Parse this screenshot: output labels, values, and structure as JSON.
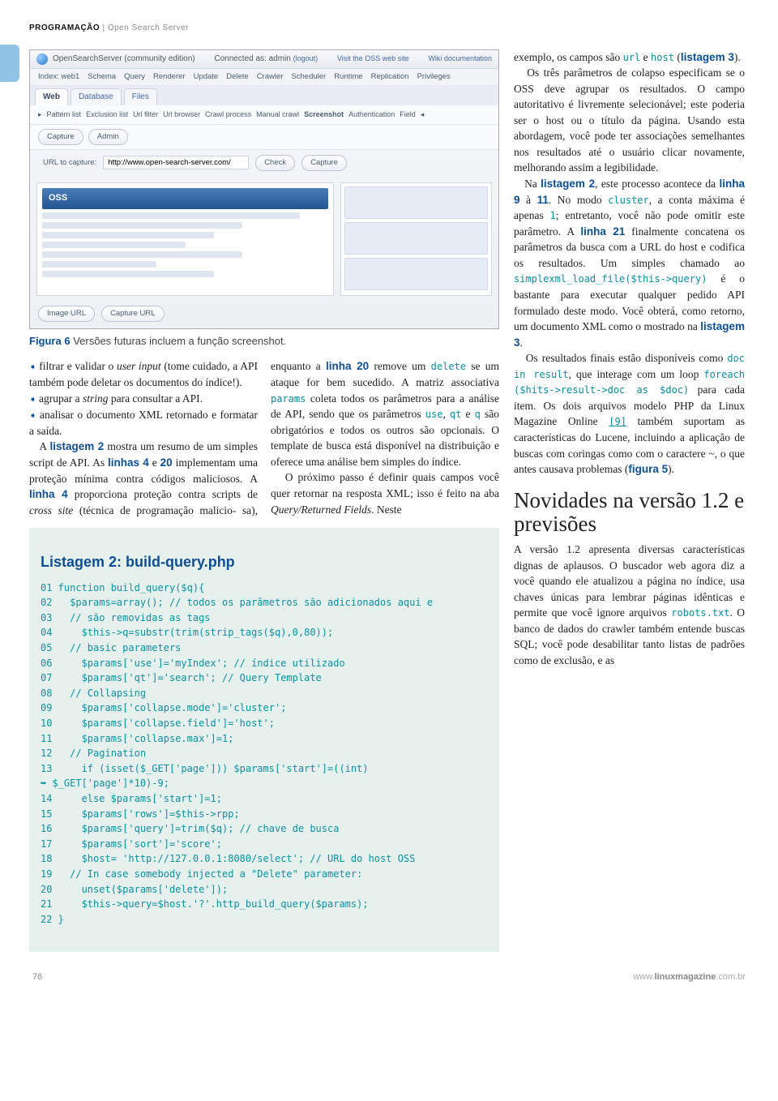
{
  "header": {
    "section": "PROGRAMAÇÃO",
    "divider": "|",
    "topic": "Open Search Server"
  },
  "shot": {
    "title": "OpenSearchServer (community edition)",
    "topRightA": "Connected as: admin",
    "topRightALogout": "(logout)",
    "topRightB": "Visit the OSS web site",
    "topRightC": "Wiki documentation",
    "row1": [
      "Index: web1",
      "Schema",
      "Query",
      "Renderer",
      "Update",
      "Delete",
      "Crawler",
      "Scheduler",
      "Runtime",
      "Replication",
      "Privileges"
    ],
    "tabs": [
      "Web",
      "Database",
      "Files"
    ],
    "row2": [
      "Pattern list",
      "Exclusion list",
      "Url filter",
      "Url browser",
      "Crawl process",
      "Manual crawl",
      "Screenshot",
      "Authentication",
      "Field"
    ],
    "row3": [
      "Capture",
      "Admin"
    ],
    "urlLabel": "URL to capture:",
    "urlValue": "http://www.open-search-server.com/",
    "btnCheck": "Check",
    "btnCapture": "Capture",
    "hero": "OSS",
    "btnImg": "Image URL",
    "btnCap": "Capture URL"
  },
  "figCaption": {
    "label": "Figura 6",
    "text": "Versões futuras incluem a função screenshot."
  },
  "col1": {
    "p1a": "filtrar e validar o ",
    "p1i": "user input",
    "p1b": " (tome cuidado, a API também pode deletar os documentos do índice!).",
    "p2a": "agrupar a ",
    "p2i": "string",
    "p2b": " para consultar a API.",
    "p3": "analisar o documento XML retornado e formatar a saída.",
    "p4a": "A ",
    "p4b": "listagem 2",
    "p4c": " mostra um resumo de um simples script de API. As ",
    "p4d": "linhas 4",
    "p4e": " e ",
    "p4f": "20",
    "p4g": " implementam uma proteção mínima contra códigos maliciosos. A ",
    "p4h": "linha 4",
    "p4i": " proporciona proteção contra scripts de ",
    "p4j": "cross site",
    "p4k": " (técnica de programação malicio-"
  },
  "col2": {
    "p1a": "sa), enquanto a ",
    "p1b": "linha 20",
    "p1c": " remove um ",
    "p1d": "delete",
    "p1e": " se um ataque for bem sucedido. A matriz associativa ",
    "p1f": "params",
    "p1g": " coleta todos os parâmetros para a análise de API, sendo que os parâmetros ",
    "p1h": "use",
    "p1i": ", ",
    "p1j": "qt",
    "p1k": " e ",
    "p1l": "q",
    "p1m": " são obrigatórios e todos os outros são opcionais. O template de busca está disponível na distribuição e oferece uma análise bem simples do índice.",
    "p2a": "O próximo passo é definir quais campos você quer retornar na resposta XML; isso é feito na aba ",
    "p2b": "Query/Returned Fields",
    "p2c": ". Neste"
  },
  "listing": {
    "title": "Listagem 2: build-query.php",
    "lines": [
      "01 function build_query($q){",
      "02   $params=array(); // todos os parâmetros são adicionados aqui e",
      "03   // são removidas as tags",
      "04     $this->q=substr(trim(strip_tags($q),0,80));",
      "05   // basic parameters",
      "06     $params['use']='myIndex'; // índice utilizado",
      "07     $params['qt']='search'; // Query Template",
      "08   // Collapsing",
      "09     $params['collapse.mode']='cluster';",
      "10     $params['collapse.field']='host';",
      "11     $params['collapse.max']=1;",
      "12   // Pagination",
      "13     if (isset($_GET['page'])) $params['start']=((int)",
      "➥ $_GET['page']*10)-9;",
      "14     else $params['start']=1;",
      "15     $params['rows']=$this->rpp;",
      "16     $params['query']=trim($q); // chave de busca",
      "17     $params['sort']='score';",
      "18     $host= 'http://127.0.0.1:8080/select'; // URL do host OSS",
      "19   // In case somebody injected a \"Delete\" parameter:",
      "20     unset($params['delete']);",
      "21     $this->query=$host.'?'.http_build_query($params);",
      "22 }"
    ]
  },
  "right": {
    "p1a": "exemplo, os campos são ",
    "p1b": "url",
    "p1c": " e ",
    "p1d": "host",
    "p1e": " (",
    "p1f": "listagem 3",
    "p1g": ").",
    "p2": "Os três parâmetros de colapso especificam se o OSS deve agrupar os resultados. O campo autoritativo é livremente selecionável; este poderia ser o host ou o título da página. Usando esta abordagem, você pode ter associações semelhantes nos resultados até o usuário clicar novamente, melhorando assim a legibilidade.",
    "p3a": "Na ",
    "p3b": "listagem 2",
    "p3c": ", este processo acontece da ",
    "p3d": "linha 9",
    "p3e": " à ",
    "p3f": "11",
    "p3g": ". No modo ",
    "p3h": "cluster",
    "p3i": ", a conta máxima é apenas ",
    "p3j": "1",
    "p3k": "; entretanto, você não pode omitir este parâmetro. A ",
    "p3l": "linha 21",
    "p3m": " finalmente concatena os parâmetros da busca com a URL do host e codifica os resultados. Um simples chamado ao ",
    "p3n": "simplexml_load_file($this->query)",
    "p3o": " é o bastante para executar qualquer pedido API formulado deste modo. Você obterá, como retorno, um documento XML como o mostrado na ",
    "p3p": "listagem 3",
    "p3q": ".",
    "p4a": "Os resultados finais estão disponíveis como ",
    "p4b": "doc in result",
    "p4c": ", que interage com um loop ",
    "p4d": "foreach ($hits->result->doc as $doc)",
    "p4e": " para cada item. Os dois arquivos modelo PHP da Linux Magazine Online ",
    "p4f": "[9]",
    "p4g": " também suportam as características do Lucene, incluindo a aplicação de buscas com coringas como com o caractere ~, o que antes causava problemas (",
    "p4h": "figura 5",
    "p4i": ").",
    "h2": "Novidades na versão 1.2 e previsões",
    "p5a": "A versão 1.2 apresenta diversas características dignas de aplausos. O buscador web agora diz a você quando ele atualizou a página no índice, usa chaves únicas para lembrar páginas idênticas e permite que você ignore arquivos ",
    "p5b": "robots.txt",
    "p5c": ". O banco de dados do crawler também entende buscas SQL; você pode desabilitar tanto listas de padrões como de exclusão, e as"
  },
  "footer": {
    "page": "76",
    "site_full": "www.linuxmagazine.com.br",
    "site_bold": "linuxmagazine"
  }
}
